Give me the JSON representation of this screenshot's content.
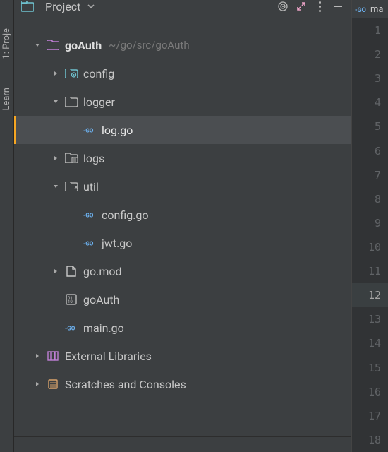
{
  "topbar": {
    "title": "Project"
  },
  "sidebar_labels": {
    "project": "1: Proje",
    "learn": "Learn"
  },
  "root": {
    "name": "goAuth",
    "path": "~/go/src/goAuth"
  },
  "tree": {
    "config": "config",
    "logger": "logger",
    "log_go": "log.go",
    "logs": "logs",
    "util": "util",
    "config_go": "config.go",
    "jwt_go": "jwt.go",
    "go_mod": "go.mod",
    "goauth_bin": "goAuth",
    "main_go": "main.go",
    "ext_libs": "External Libraries",
    "scratches": "Scratches and Consoles"
  },
  "editor": {
    "tab_truncated": "ma",
    "current_line": 12,
    "lines": [
      1,
      2,
      3,
      4,
      5,
      6,
      7,
      8,
      9,
      10,
      11,
      12,
      13,
      14,
      15,
      16,
      17,
      18
    ]
  }
}
